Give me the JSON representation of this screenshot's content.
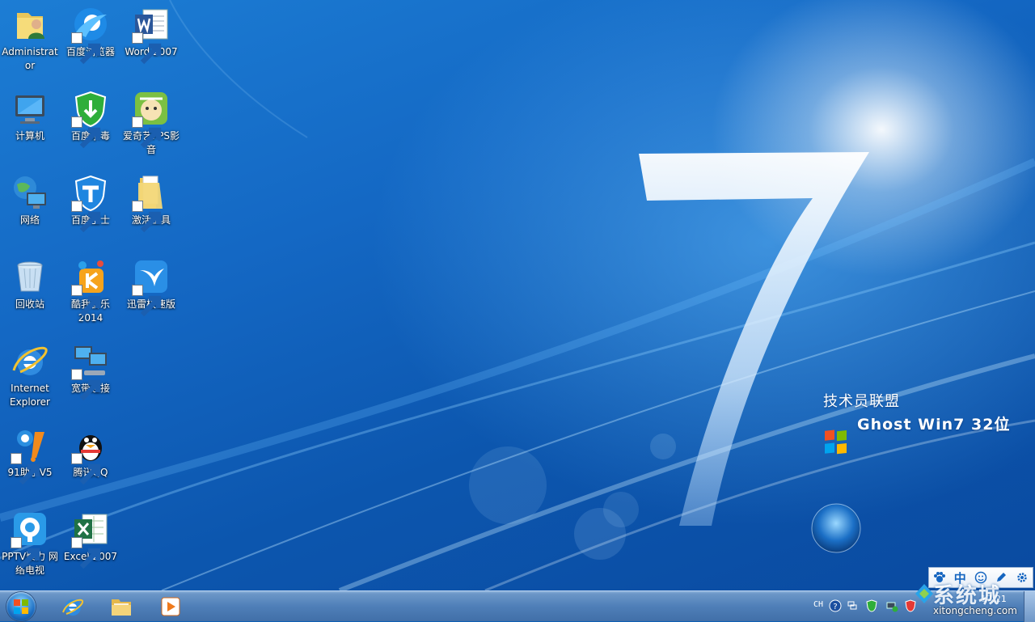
{
  "desktop": {
    "brand_line1": "技术员联盟",
    "brand_line2": "Ghost Win7 32位",
    "icons": [
      {
        "label": "Administrator",
        "icon": "user-folder-icon"
      },
      {
        "label": "百度浏览器",
        "icon": "baidu-browser-icon"
      },
      {
        "label": "Word 2007",
        "icon": "word-icon"
      },
      {
        "label": "计算机",
        "icon": "computer-icon"
      },
      {
        "label": "百度杀毒",
        "icon": "baidu-antivirus-icon"
      },
      {
        "label": "爱奇艺PPS影音",
        "icon": "pps-icon"
      },
      {
        "label": "网络",
        "icon": "network-icon"
      },
      {
        "label": "百度卫士",
        "icon": "baidu-guard-icon"
      },
      {
        "label": "激活工具",
        "icon": "folder-icon"
      },
      {
        "label": "回收站",
        "icon": "recycle-bin-icon"
      },
      {
        "label": "酷我音乐2014",
        "icon": "kuwo-music-icon"
      },
      {
        "label": "迅雷极速版",
        "icon": "xunlei-icon"
      },
      {
        "label": "Internet Explorer",
        "icon": "ie-icon"
      },
      {
        "label": "宽带连接",
        "icon": "broadband-icon"
      },
      {
        "label": "91助手V5",
        "icon": "91-assistant-icon"
      },
      {
        "label": "腾讯QQ",
        "icon": "qq-icon"
      },
      {
        "label": "PPTV聚力 网络电视",
        "icon": "pptv-icon"
      },
      {
        "label": "Excel 2007",
        "icon": "excel-icon"
      }
    ]
  },
  "ime_bar": {
    "mode": "中"
  },
  "taskbar": {
    "pinned": [
      {
        "name": "Internet Explorer",
        "icon": "ie-icon"
      },
      {
        "name": "Windows Explorer",
        "icon": "folder-icon"
      },
      {
        "name": "Media Player",
        "icon": "media-player-icon"
      }
    ],
    "tray": {
      "language": "CH",
      "time": "17:21"
    }
  },
  "watermark": {
    "text": "系统城",
    "url": "xitongcheng.com"
  },
  "colors": {
    "wallpaper_blue": "#1468c4",
    "taskbar_blue": "#4f7fb8",
    "ime_blue": "#1565c0"
  }
}
